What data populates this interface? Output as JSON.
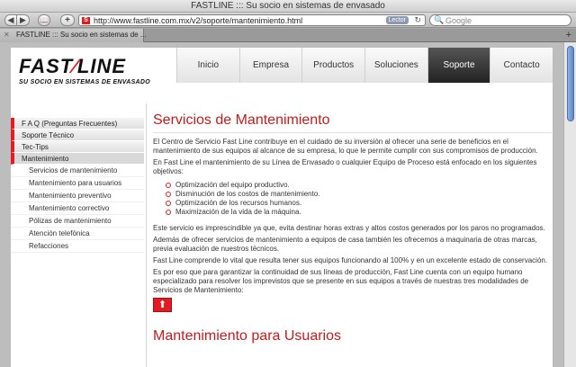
{
  "window": {
    "title": "FASTLINE ::: Su socio en sistemas de envasado"
  },
  "toolbar": {
    "back_glyph": "◀",
    "forward_glyph": "▶",
    "bookmarks_glyph": "📖",
    "add_glyph": "+",
    "favicon_glyph": "S",
    "url": "http://www.fastline.com.mx/v2/soporte/mantenimiento.html",
    "reader_label": "Lector",
    "reload_glyph": "↻",
    "search_icon_glyph": "🔍",
    "search_placeholder": "Google"
  },
  "tabs": {
    "active_label": "FASTLINE ::: Su socio en sistemas de ...",
    "close_glyph": "✕",
    "new_tab_glyph": "+"
  },
  "logo": {
    "mark_left": "FAST",
    "mark_right": "LINE",
    "slogan": "SU SOCIO EN SISTEMAS DE ENVASADO"
  },
  "nav": {
    "items": [
      "Inicio",
      "Empresa",
      "Productos",
      "Soluciones",
      "Soporte",
      "Contacto"
    ],
    "active": "Soporte"
  },
  "sidebar": {
    "sections": [
      "F A Q (Preguntas Frecuentes)",
      "Soporte Técnico",
      "Tec-Tips",
      "Mantenimiento"
    ],
    "subitems": [
      "Servicios de mantenimiento",
      "Mantenimiento para usuarios",
      "Mantenimiento preventivo",
      "Mantenimiento correctivo",
      "Pólizas de mantenimiento",
      "Atención telefónica",
      "Refacciones"
    ]
  },
  "content": {
    "title": "Servicios de Mantenimiento",
    "intro": "El Centro de Servicio Fast Line contribuye en el cuidado de su inversión al ofrecer una serie de beneficios en el mantenimiento de sus equipos al alcance de su empresa, lo que le permite cumplir con sus compromisos de producción.",
    "focus": "En Fast Line el mantenimiento de su Línea de Envasado o cualquier Equipo de Proceso está enfocado en los siguientes objetivos:",
    "objectives": [
      "Optimización del equipo productivo.",
      "Disminución de los costos de mantenimiento.",
      "Optimización de los recursos humanos.",
      "Maximización de la vida de la máquina."
    ],
    "p1": "Este servicio es imprescindible ya que, evita destinar horas extras y altos costos generados por los paros no programados.",
    "p2": "Además de ofrecer servicios de mantenimiento a equipos de casa también les ofrecemos a maquinaria de otras marcas, previa evaluación de nuestros técnicos.",
    "p3": "Fast Line comprende lo vital que resulta tener sus equipos funcionando al 100% y en un excelente estado de conservación.",
    "p4": "Es por eso que para garantizar la continuidad de sus líneas de producción, Fast Line cuenta con un equipo humano especializado para resolver los imprevistos que se presente en sus equipos a través de nuestras tres modalidades de Servicios de Mantenimiento:",
    "up_glyph": "⬆",
    "next_title": "Mantenimiento para Usuarios"
  }
}
